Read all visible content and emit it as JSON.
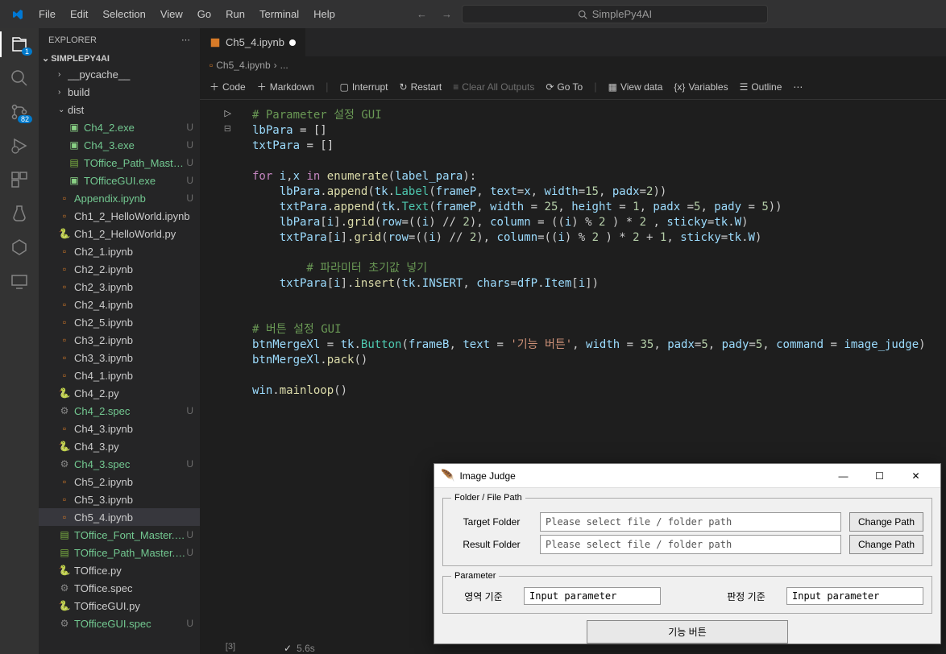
{
  "menu": [
    "File",
    "Edit",
    "Selection",
    "View",
    "Go",
    "Run",
    "Terminal",
    "Help"
  ],
  "search_placeholder": "SimplePy4AI",
  "explorer": {
    "title": "EXPLORER",
    "root": "SIMPLEPY4AI",
    "badge": "82",
    "items": [
      {
        "type": "folder",
        "name": "__pycache__",
        "open": false,
        "indent": 1
      },
      {
        "type": "folder",
        "name": "build",
        "open": false,
        "indent": 1
      },
      {
        "type": "folder",
        "name": "dist",
        "open": true,
        "indent": 1
      },
      {
        "type": "file",
        "name": "Ch4_2.exe",
        "icon": "exe",
        "status": "U",
        "cls": "untracked",
        "indent": 2
      },
      {
        "type": "file",
        "name": "Ch4_3.exe",
        "icon": "exe",
        "status": "U",
        "cls": "untracked",
        "indent": 2
      },
      {
        "type": "file",
        "name": "TOffice_Path_Master....",
        "icon": "csv",
        "status": "U",
        "cls": "untracked",
        "indent": 2
      },
      {
        "type": "file",
        "name": "TOfficeGUI.exe",
        "icon": "exe",
        "status": "U",
        "cls": "untracked",
        "indent": 2
      },
      {
        "type": "file",
        "name": "Appendix.ipynb",
        "icon": "nb",
        "status": "U",
        "cls": "untracked",
        "indent": 1
      },
      {
        "type": "file",
        "name": "Ch1_2_HelloWorld.ipynb",
        "icon": "nb",
        "indent": 1
      },
      {
        "type": "file",
        "name": "Ch1_2_HelloWorld.py",
        "icon": "py",
        "indent": 1
      },
      {
        "type": "file",
        "name": "Ch2_1.ipynb",
        "icon": "nb",
        "indent": 1
      },
      {
        "type": "file",
        "name": "Ch2_2.ipynb",
        "icon": "nb",
        "indent": 1
      },
      {
        "type": "file",
        "name": "Ch2_3.ipynb",
        "icon": "nb",
        "indent": 1
      },
      {
        "type": "file",
        "name": "Ch2_4.ipynb",
        "icon": "nb",
        "indent": 1
      },
      {
        "type": "file",
        "name": "Ch2_5.ipynb",
        "icon": "nb",
        "indent": 1
      },
      {
        "type": "file",
        "name": "Ch3_2.ipynb",
        "icon": "nb",
        "indent": 1
      },
      {
        "type": "file",
        "name": "Ch3_3.ipynb",
        "icon": "nb",
        "indent": 1
      },
      {
        "type": "file",
        "name": "Ch4_1.ipynb",
        "icon": "nb",
        "indent": 1
      },
      {
        "type": "file",
        "name": "Ch4_2.py",
        "icon": "py",
        "indent": 1
      },
      {
        "type": "file",
        "name": "Ch4_2.spec",
        "icon": "gear",
        "status": "U",
        "cls": "untracked",
        "indent": 1
      },
      {
        "type": "file",
        "name": "Ch4_3.ipynb",
        "icon": "nb",
        "indent": 1
      },
      {
        "type": "file",
        "name": "Ch4_3.py",
        "icon": "py",
        "indent": 1
      },
      {
        "type": "file",
        "name": "Ch4_3.spec",
        "icon": "gear",
        "status": "U",
        "cls": "untracked",
        "indent": 1
      },
      {
        "type": "file",
        "name": "Ch5_2.ipynb",
        "icon": "nb",
        "indent": 1
      },
      {
        "type": "file",
        "name": "Ch5_3.ipynb",
        "icon": "nb",
        "indent": 1
      },
      {
        "type": "file",
        "name": "Ch5_4.ipynb",
        "icon": "nb",
        "selected": true,
        "indent": 1
      },
      {
        "type": "file",
        "name": "TOffice_Font_Master.csv",
        "icon": "csv",
        "status": "U",
        "cls": "untracked",
        "indent": 1
      },
      {
        "type": "file",
        "name": "TOffice_Path_Master.csv",
        "icon": "csv",
        "status": "U",
        "cls": "untracked",
        "indent": 1
      },
      {
        "type": "file",
        "name": "TOffice.py",
        "icon": "py",
        "indent": 1
      },
      {
        "type": "file",
        "name": "TOffice.spec",
        "icon": "gear",
        "indent": 1
      },
      {
        "type": "file",
        "name": "TOfficeGUI.py",
        "icon": "py",
        "indent": 1
      },
      {
        "type": "file",
        "name": "TOfficeGUI.spec",
        "icon": "gear",
        "status": "U",
        "cls": "untracked",
        "indent": 1
      }
    ]
  },
  "tab": {
    "name": "Ch5_4.ipynb"
  },
  "breadcrumb": {
    "file": "Ch5_4.ipynb",
    "sep": "›",
    "more": "..."
  },
  "toolbar": {
    "code": "Code",
    "markdown": "Markdown",
    "interrupt": "Interrupt",
    "restart": "Restart",
    "clear": "Clear All Outputs",
    "goto": "Go To",
    "viewdata": "View data",
    "variables": "Variables",
    "outline": "Outline"
  },
  "cell": {
    "exec_count": "[3]",
    "exec_time": "5.6s"
  },
  "code_lines": {
    "c1": "# Parameter 설정 GUI",
    "c2a": "lbPara",
    "c2b": " = []",
    "c3a": "txtPara",
    "c3b": " = []",
    "c4a": "for",
    "c4b": " i,x ",
    "c4c": "in",
    "c4d": " enumerate",
    "c4e": "(label_para):",
    "c5": "    lbPara.append(tk.Label(frameP, text=x, width=15, padx=2))",
    "c6": "    txtPara.append(tk.Text(frameP, width = 25, height = 1, padx =5, pady = 5))",
    "c7": "    lbPara[i].grid(row=((i) // 2), column = ((i) % 2 ) * 2 , sticky=tk.W)",
    "c8": "    txtPara[i].grid(row=((i) // 2), column=((i) % 2 ) * 2 + 1, sticky=tk.W)",
    "c9": "    # 파라미터 초기값 넣기",
    "c10": "    txtPara[i].insert(tk.INSERT, chars=dfP.Item[i])",
    "c11": "# 버튼 설정 GUI",
    "c12": "btnMergeXl = tk.Button(frameB, text = '기능 버튼', width = 35, padx=5, pady=5, command = image_judge)",
    "c13": "btnMergeXl.pack()",
    "c14": "win.mainloop()"
  },
  "tk": {
    "title": "Image Judge",
    "fs1": "Folder / File Path",
    "target_label": "Target Folder",
    "result_label": "Result Folder",
    "path_placeholder": "Please select file / folder path",
    "change_btn": "Change Path",
    "fs2": "Parameter",
    "param1_label": "영역 기준",
    "param2_label": "판정 기준",
    "param_placeholder": "Input parameter",
    "main_btn": "기능 버튼"
  }
}
